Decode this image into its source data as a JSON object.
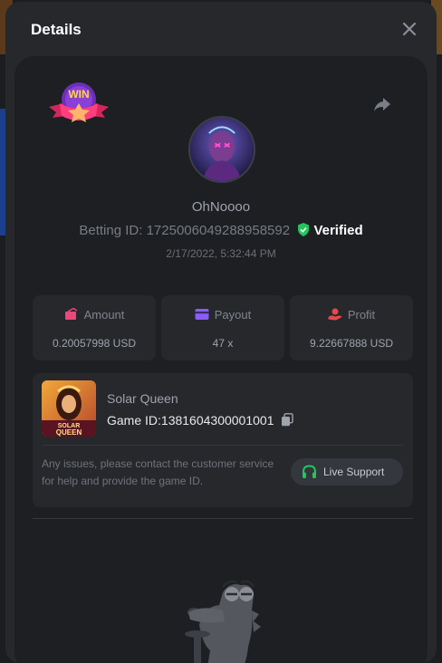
{
  "modal": {
    "title": "Details"
  },
  "player": {
    "username": "OhNoooo",
    "betting_id_label": "Betting ID:",
    "betting_id": "1725006049288958592",
    "verified_label": "Verified",
    "timestamp": "2/17/2022, 5:32:44 PM"
  },
  "badge": {
    "text": "WIN"
  },
  "stats": {
    "amount": {
      "label": "Amount",
      "value": "0.20057998 USD"
    },
    "payout": {
      "label": "Payout",
      "value": "47 x"
    },
    "profit": {
      "label": "Profit",
      "value": "9.22667888 USD"
    }
  },
  "game": {
    "name": "Solar Queen",
    "id_label": "Game ID:",
    "id": "1381604300001001",
    "thumb_text_1": "SOLAR",
    "thumb_text_2": "QUEEN"
  },
  "support": {
    "message": "Any issues, please contact the customer service for help and provide the game ID.",
    "button_label": "Live Support"
  },
  "colors": {
    "verified": "#22c55e",
    "amount_icon": "#e8487a",
    "payout_icon": "#8b5cf6",
    "profit_icon": "#e8484a",
    "live_support_icon": "#22c55e"
  }
}
